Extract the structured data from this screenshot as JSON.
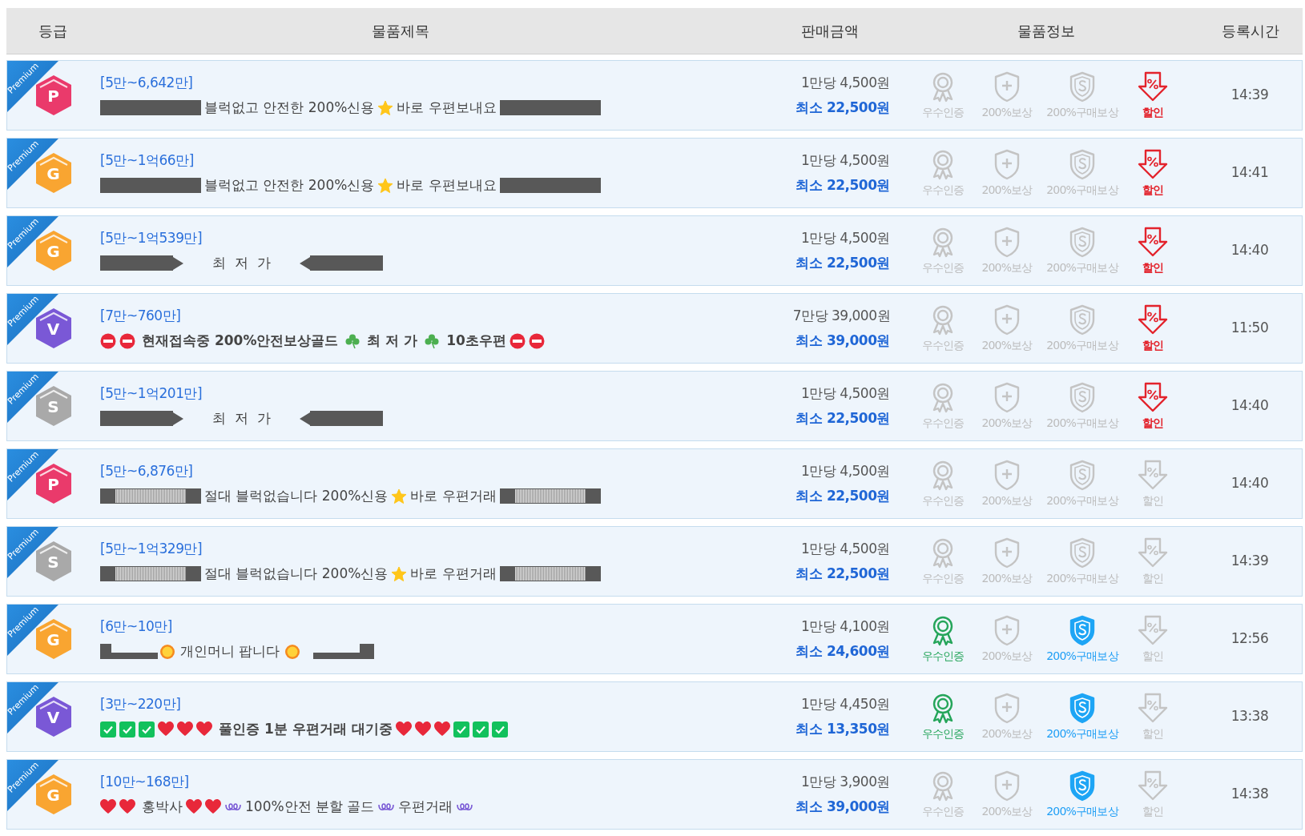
{
  "header": [
    "등급",
    "물품제목",
    "판매금액",
    "물품정보",
    "등록시간"
  ],
  "rows": [
    {
      "ribbon": "Premium",
      "grade": {
        "letter": "P",
        "color": "#ea3a6b"
      },
      "range": "[5만~6,642만]",
      "bold": false,
      "title": [
        {
          "kind": "redacted"
        },
        {
          "kind": "text",
          "text": "블럭없고 안전한 200%신용"
        },
        {
          "kind": "star"
        },
        {
          "kind": "text",
          "text": "바로 우편보내요"
        },
        {
          "kind": "redacted"
        }
      ],
      "rate": "1만당 4,500원",
      "min": "최소 22,500원",
      "badges": [
        {
          "kind": "award",
          "label": "우수인증",
          "on": false
        },
        {
          "kind": "shield-plus",
          "label": "200%보상",
          "on": false
        },
        {
          "kind": "shield-s",
          "label": "200%구매보상",
          "on": false
        },
        {
          "kind": "discount",
          "label": "할인",
          "on": true
        }
      ],
      "time": "14:39"
    },
    {
      "ribbon": "Premium",
      "grade": {
        "letter": "G",
        "color": "#f9a531"
      },
      "range": "[5만~1억66만]",
      "bold": false,
      "title": [
        {
          "kind": "redacted"
        },
        {
          "kind": "text",
          "text": "블럭없고 안전한 200%신용"
        },
        {
          "kind": "star"
        },
        {
          "kind": "text",
          "text": "바로 우편보내요"
        },
        {
          "kind": "redacted"
        }
      ],
      "rate": "1만당 4,500원",
      "min": "최소 22,500원",
      "badges": [
        {
          "kind": "award",
          "label": "우수인증",
          "on": false
        },
        {
          "kind": "shield-plus",
          "label": "200%보상",
          "on": false
        },
        {
          "kind": "shield-s",
          "label": "200%구매보상",
          "on": false
        },
        {
          "kind": "discount",
          "label": "할인",
          "on": true
        }
      ],
      "time": "14:41"
    },
    {
      "ribbon": "Premium",
      "grade": {
        "letter": "G",
        "color": "#f9a531"
      },
      "range": "[5만~1억539만]",
      "bold": false,
      "title": [
        {
          "kind": "redacted-short"
        },
        {
          "kind": "arrow-right"
        },
        {
          "kind": "text",
          "text": "최  저  가"
        },
        {
          "kind": "arrow-left"
        },
        {
          "kind": "redacted-short"
        }
      ],
      "rate": "1만당 4,500원",
      "min": "최소 22,500원",
      "badges": [
        {
          "kind": "award",
          "label": "우수인증",
          "on": false
        },
        {
          "kind": "shield-plus",
          "label": "200%보상",
          "on": false
        },
        {
          "kind": "shield-s",
          "label": "200%구매보상",
          "on": false
        },
        {
          "kind": "discount",
          "label": "할인",
          "on": true
        }
      ],
      "time": "14:40"
    },
    {
      "ribbon": "Premium",
      "grade": {
        "letter": "V",
        "color": "#7a58d6"
      },
      "range": "[7만~760만]",
      "bold": true,
      "title": [
        {
          "kind": "no-entry"
        },
        {
          "kind": "no-entry"
        },
        {
          "kind": "text",
          "text": "현재접속중 200%안전보상골드"
        },
        {
          "kind": "clover"
        },
        {
          "kind": "text",
          "text": "최 저 가"
        },
        {
          "kind": "clover"
        },
        {
          "kind": "text",
          "text": "10초우편"
        },
        {
          "kind": "no-entry"
        },
        {
          "kind": "no-entry"
        }
      ],
      "rate": "7만당 39,000원",
      "min": "최소 39,000원",
      "badges": [
        {
          "kind": "award",
          "label": "우수인증",
          "on": false
        },
        {
          "kind": "shield-plus",
          "label": "200%보상",
          "on": false
        },
        {
          "kind": "shield-s",
          "label": "200%구매보상",
          "on": false
        },
        {
          "kind": "discount",
          "label": "할인",
          "on": true
        }
      ],
      "time": "11:50"
    },
    {
      "ribbon": "Premium",
      "grade": {
        "letter": "S",
        "color": "#a9a9a9"
      },
      "range": "[5만~1억201만]",
      "bold": false,
      "title": [
        {
          "kind": "redacted-short"
        },
        {
          "kind": "arrow-right"
        },
        {
          "kind": "text",
          "text": "최  저  가"
        },
        {
          "kind": "arrow-left"
        },
        {
          "kind": "redacted-short"
        }
      ],
      "rate": "1만당 4,500원",
      "min": "최소 22,500원",
      "badges": [
        {
          "kind": "award",
          "label": "우수인증",
          "on": false
        },
        {
          "kind": "shield-plus",
          "label": "200%보상",
          "on": false
        },
        {
          "kind": "shield-s",
          "label": "200%구매보상",
          "on": false
        },
        {
          "kind": "discount",
          "label": "할인",
          "on": true
        }
      ],
      "time": "14:40"
    },
    {
      "ribbon": "Premium",
      "grade": {
        "letter": "P",
        "color": "#ea3a6b"
      },
      "range": "[5만~6,876만]",
      "bold": false,
      "title": [
        {
          "kind": "redacted-dotted"
        },
        {
          "kind": "text",
          "text": "절대 블럭없습니다 200%신용"
        },
        {
          "kind": "star"
        },
        {
          "kind": "text",
          "text": "바로 우편거래"
        },
        {
          "kind": "redacted-dotted"
        }
      ],
      "rate": "1만당 4,500원",
      "min": "최소 22,500원",
      "badges": [
        {
          "kind": "award",
          "label": "우수인증",
          "on": false
        },
        {
          "kind": "shield-plus",
          "label": "200%보상",
          "on": false
        },
        {
          "kind": "shield-s",
          "label": "200%구매보상",
          "on": false
        },
        {
          "kind": "discount",
          "label": "할인",
          "on": false
        }
      ],
      "time": "14:40"
    },
    {
      "ribbon": "Premium",
      "grade": {
        "letter": "S",
        "color": "#a9a9a9"
      },
      "range": "[5만~1억329만]",
      "bold": false,
      "title": [
        {
          "kind": "redacted-dotted"
        },
        {
          "kind": "text",
          "text": "절대 블럭없습니다 200%신용"
        },
        {
          "kind": "star"
        },
        {
          "kind": "text",
          "text": "바로 우편거래"
        },
        {
          "kind": "redacted-dotted"
        }
      ],
      "rate": "1만당 4,500원",
      "min": "최소 22,500원",
      "badges": [
        {
          "kind": "award",
          "label": "우수인증",
          "on": false
        },
        {
          "kind": "shield-plus",
          "label": "200%보상",
          "on": false
        },
        {
          "kind": "shield-s",
          "label": "200%구매보상",
          "on": false
        },
        {
          "kind": "discount",
          "label": "할인",
          "on": false
        }
      ],
      "time": "14:39"
    },
    {
      "ribbon": "Premium",
      "grade": {
        "letter": "G",
        "color": "#f9a531"
      },
      "range": "[6만~10만]",
      "bold": false,
      "title": [
        {
          "kind": "redacted-step"
        },
        {
          "kind": "sun"
        },
        {
          "kind": "text",
          "text": "개인머니 팝니다"
        },
        {
          "kind": "sun"
        },
        {
          "kind": "redacted-step-end"
        }
      ],
      "rate": "1만당 4,100원",
      "min": "최소 24,600원",
      "badges": [
        {
          "kind": "award",
          "label": "우수인증",
          "on": true
        },
        {
          "kind": "shield-plus",
          "label": "200%보상",
          "on": false
        },
        {
          "kind": "shield-s",
          "label": "200%구매보상",
          "on": true
        },
        {
          "kind": "discount",
          "label": "할인",
          "on": false
        }
      ],
      "time": "12:56"
    },
    {
      "ribbon": "Premium",
      "grade": {
        "letter": "V",
        "color": "#7a58d6"
      },
      "range": "[3만~220만]",
      "bold": true,
      "title": [
        {
          "kind": "check"
        },
        {
          "kind": "check"
        },
        {
          "kind": "check"
        },
        {
          "kind": "heart"
        },
        {
          "kind": "heart"
        },
        {
          "kind": "heart"
        },
        {
          "kind": "text",
          "text": "풀인증 1분 우편거래 대기중"
        },
        {
          "kind": "heart"
        },
        {
          "kind": "heart"
        },
        {
          "kind": "heart"
        },
        {
          "kind": "check"
        },
        {
          "kind": "check"
        },
        {
          "kind": "check"
        }
      ],
      "rate": "1만당 4,450원",
      "min": "최소 13,350원",
      "badges": [
        {
          "kind": "award",
          "label": "우수인증",
          "on": true
        },
        {
          "kind": "shield-plus",
          "label": "200%보상",
          "on": false
        },
        {
          "kind": "shield-s",
          "label": "200%구매보상",
          "on": true
        },
        {
          "kind": "discount",
          "label": "할인",
          "on": false
        }
      ],
      "time": "13:38"
    },
    {
      "ribbon": "Premium",
      "grade": {
        "letter": "G",
        "color": "#f9a531"
      },
      "range": "[10만~168만]",
      "bold": false,
      "title": [
        {
          "kind": "heart"
        },
        {
          "kind": "heart"
        },
        {
          "kind": "text",
          "text": "홍박사"
        },
        {
          "kind": "heart"
        },
        {
          "kind": "heart"
        },
        {
          "kind": "loop"
        },
        {
          "kind": "text",
          "text": "100%안전 분할 골드"
        },
        {
          "kind": "loop"
        },
        {
          "kind": "text",
          "text": "우편거래"
        },
        {
          "kind": "loop"
        }
      ],
      "rate": "1만당 3,900원",
      "min": "최소 39,000원",
      "badges": [
        {
          "kind": "award",
          "label": "우수인증",
          "on": false
        },
        {
          "kind": "shield-plus",
          "label": "200%보상",
          "on": false
        },
        {
          "kind": "shield-s",
          "label": "200%구매보상",
          "on": true
        },
        {
          "kind": "discount",
          "label": "할인",
          "on": false
        }
      ],
      "time": "14:38"
    }
  ]
}
